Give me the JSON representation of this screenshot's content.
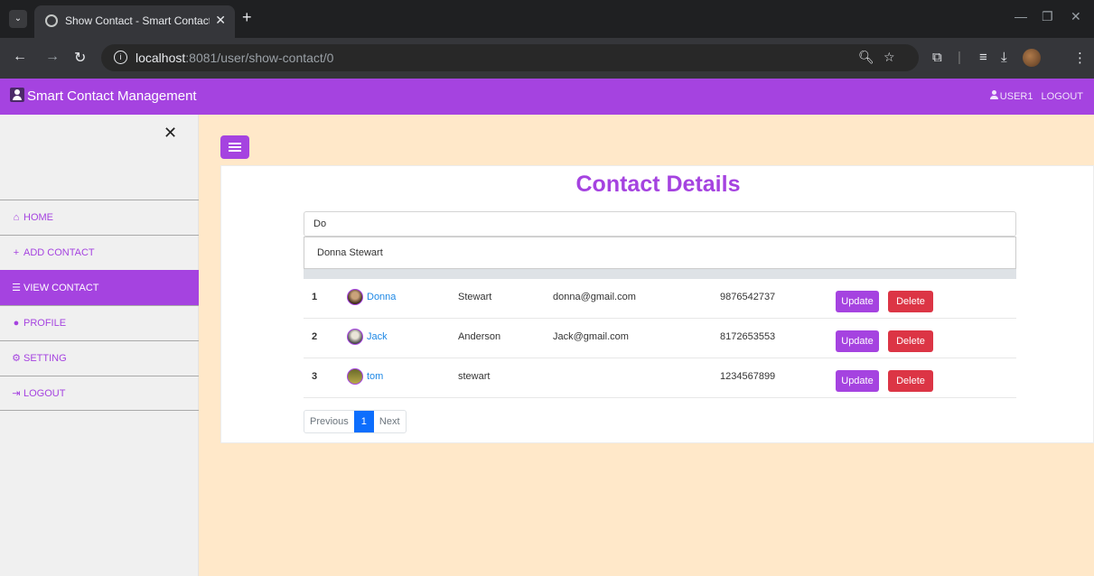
{
  "browser": {
    "tab_title": "Show Contact - Smart Contact M",
    "url_host": "localhost",
    "url_path": ":8081/user/show-contact/0"
  },
  "navbar": {
    "brand": "Smart Contact Management",
    "user": "USER1",
    "logout": "LOGOUT",
    "accent_color": "#a543e0"
  },
  "sidebar": {
    "items": [
      {
        "label": "HOME",
        "icon": "home-icon"
      },
      {
        "label": "ADD CONTACT",
        "icon": "plus-icon"
      },
      {
        "label": "VIEW CONTACT",
        "icon": "list-icon",
        "active": true
      },
      {
        "label": "PROFILE",
        "icon": "user-icon"
      },
      {
        "label": "SETTING",
        "icon": "gear-icon"
      },
      {
        "label": "LOGOUT",
        "icon": "sign-out-icon"
      }
    ]
  },
  "main": {
    "title": "Contact Details",
    "search": {
      "value": "Do"
    },
    "suggestions": [
      "Donna Stewart"
    ],
    "rows": [
      {
        "idx": "1",
        "name": "Donna",
        "last": "Stewart",
        "email": "donna@gmail.com",
        "phone": "9876542737"
      },
      {
        "idx": "2",
        "name": "Jack",
        "last": "Anderson",
        "email": "Jack@gmail.com",
        "phone": "8172653553"
      },
      {
        "idx": "3",
        "name": "tom",
        "last": "stewart",
        "email": "",
        "phone": "1234567899"
      }
    ],
    "buttons": {
      "update": "Update",
      "delete": "Delete"
    },
    "pagination": {
      "prev": "Previous",
      "current": "1",
      "next": "Next"
    }
  }
}
